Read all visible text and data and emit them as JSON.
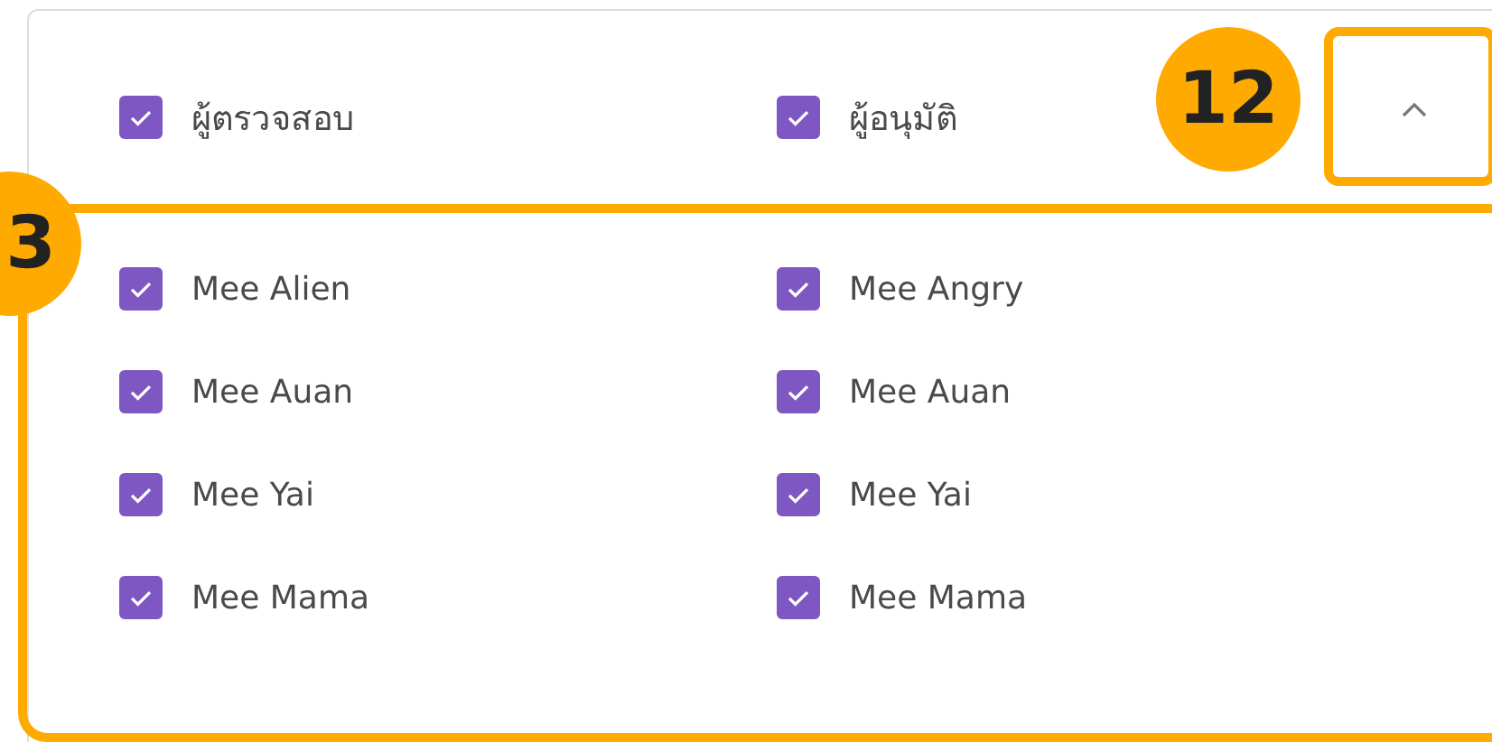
{
  "header": {
    "filters": [
      {
        "label": "ผู้ตรวจสอบ",
        "checked": true
      },
      {
        "label": "ผู้อนุมัติ",
        "checked": true
      }
    ],
    "toggle": {
      "expanded": true
    }
  },
  "columns": [
    {
      "items": [
        {
          "label": "Mee Alien",
          "checked": true
        },
        {
          "label": "Mee Auan",
          "checked": true
        },
        {
          "label": "Mee Yai",
          "checked": true
        },
        {
          "label": "Mee Mama",
          "checked": true
        }
      ]
    },
    {
      "items": [
        {
          "label": "Mee Angry",
          "checked": true
        },
        {
          "label": "Mee Auan",
          "checked": true
        },
        {
          "label": "Mee Yai",
          "checked": true
        },
        {
          "label": "Mee Mama",
          "checked": true
        }
      ]
    }
  ],
  "annotations": [
    {
      "number": "12"
    },
    {
      "number": "3"
    }
  ]
}
